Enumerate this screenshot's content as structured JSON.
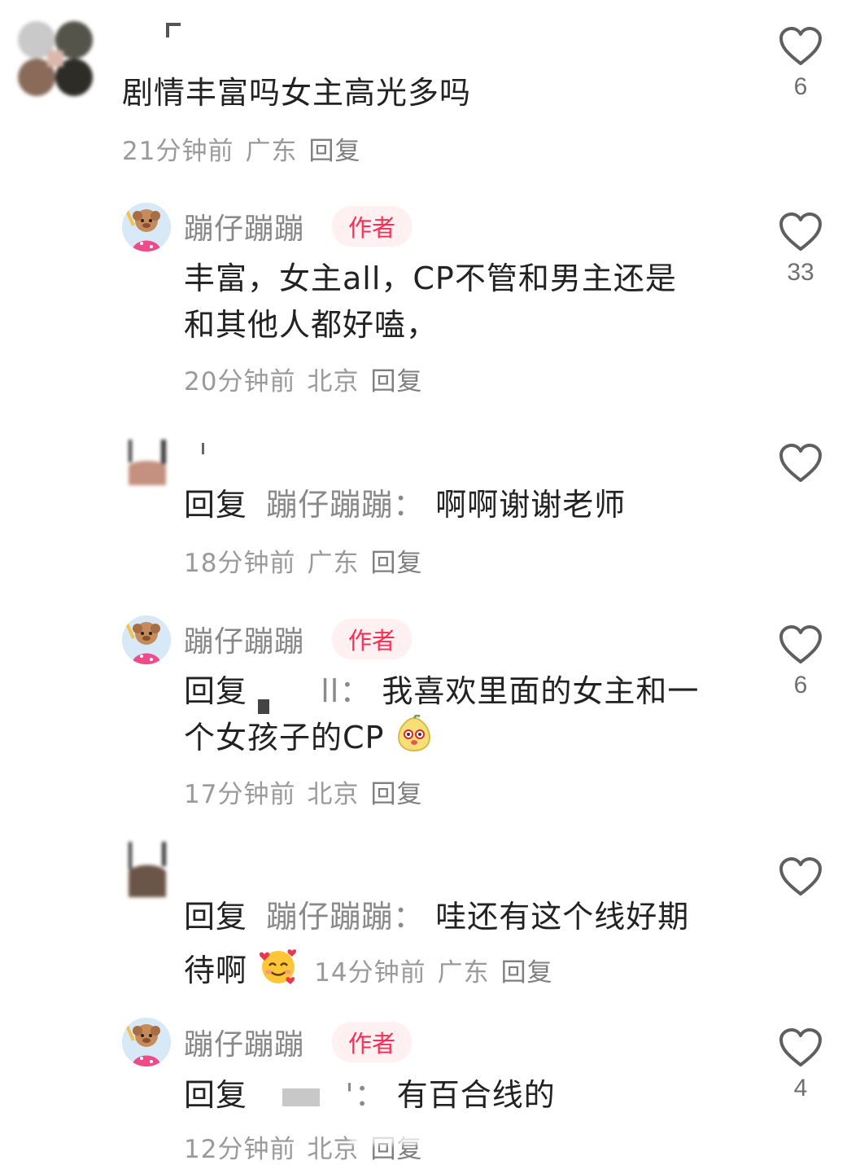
{
  "comments": [
    {
      "id": "c1",
      "text": "剧情丰富吗女主高光多吗",
      "time": "21分钟前",
      "location": "广东",
      "reply_label": "回复",
      "likes": "6"
    },
    {
      "id": "c2",
      "author": "蹦仔蹦蹦",
      "tag": "作者",
      "text_line1": "丰富，女主all，CP不管和男主还是",
      "text_line2": "和其他人都好嗑，",
      "time": "20分钟前",
      "location": "北京",
      "reply_label": "回复",
      "likes": "33"
    },
    {
      "id": "c3",
      "prefix": "回复",
      "target": "蹦仔蹦蹦：",
      "text": "啊啊谢谢老师",
      "time": "18分钟前",
      "location": "广东",
      "reply_label": "回复"
    },
    {
      "id": "c4",
      "author": "蹦仔蹦蹦",
      "tag": "作者",
      "prefix": "回复",
      "target": "ll：",
      "text_line1": "我喜欢里面的女主和一",
      "text_line2": "个女孩子的CP",
      "emoji": "mango-face-emoji",
      "time": "17分钟前",
      "location": "北京",
      "reply_label": "回复",
      "likes": "6"
    },
    {
      "id": "c5",
      "prefix": "回复",
      "target": "蹦仔蹦蹦：",
      "text_line1": "哇还有这个线好期",
      "text_line2": "待啊",
      "emoji": "smiling-face-with-hearts-emoji",
      "time": "14分钟前",
      "location": "广东",
      "reply_label": "回复"
    },
    {
      "id": "c6",
      "author": "蹦仔蹦蹦",
      "tag": "作者",
      "prefix": "回复",
      "target": "'：",
      "text": "有百合线的",
      "time": "12分钟前",
      "location": "北京",
      "reply_label": "回复",
      "likes": "4"
    }
  ],
  "icons": {
    "like": "heart-outline-icon"
  },
  "colors": {
    "author_tag_text": "#ff2d55",
    "author_tag_bg": "#fff0f1",
    "meta_text": "#9a9a9a"
  }
}
